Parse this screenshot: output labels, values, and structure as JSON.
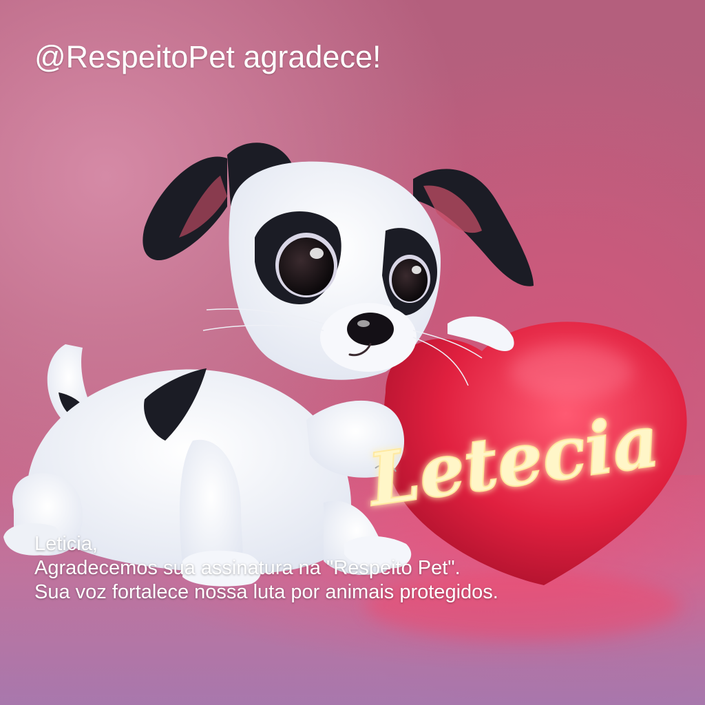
{
  "header": {
    "title": "@RespeitoPet agradece!"
  },
  "illustration": {
    "subject": "puppy-hugging-heart",
    "heart_name": "Letecia",
    "colors": {
      "background": "#b45f7d",
      "heart": "#e0203f",
      "neon_text": "#fff6c8",
      "puppy_fur": "#f2f4f8",
      "puppy_patch": "#1b1c25"
    }
  },
  "message": {
    "greeting": "Leticia,",
    "line1": "Agradecemos sua assinatura na \"Respeito Pet\".",
    "line2": "Sua voz fortalece nossa luta por animais protegidos."
  }
}
